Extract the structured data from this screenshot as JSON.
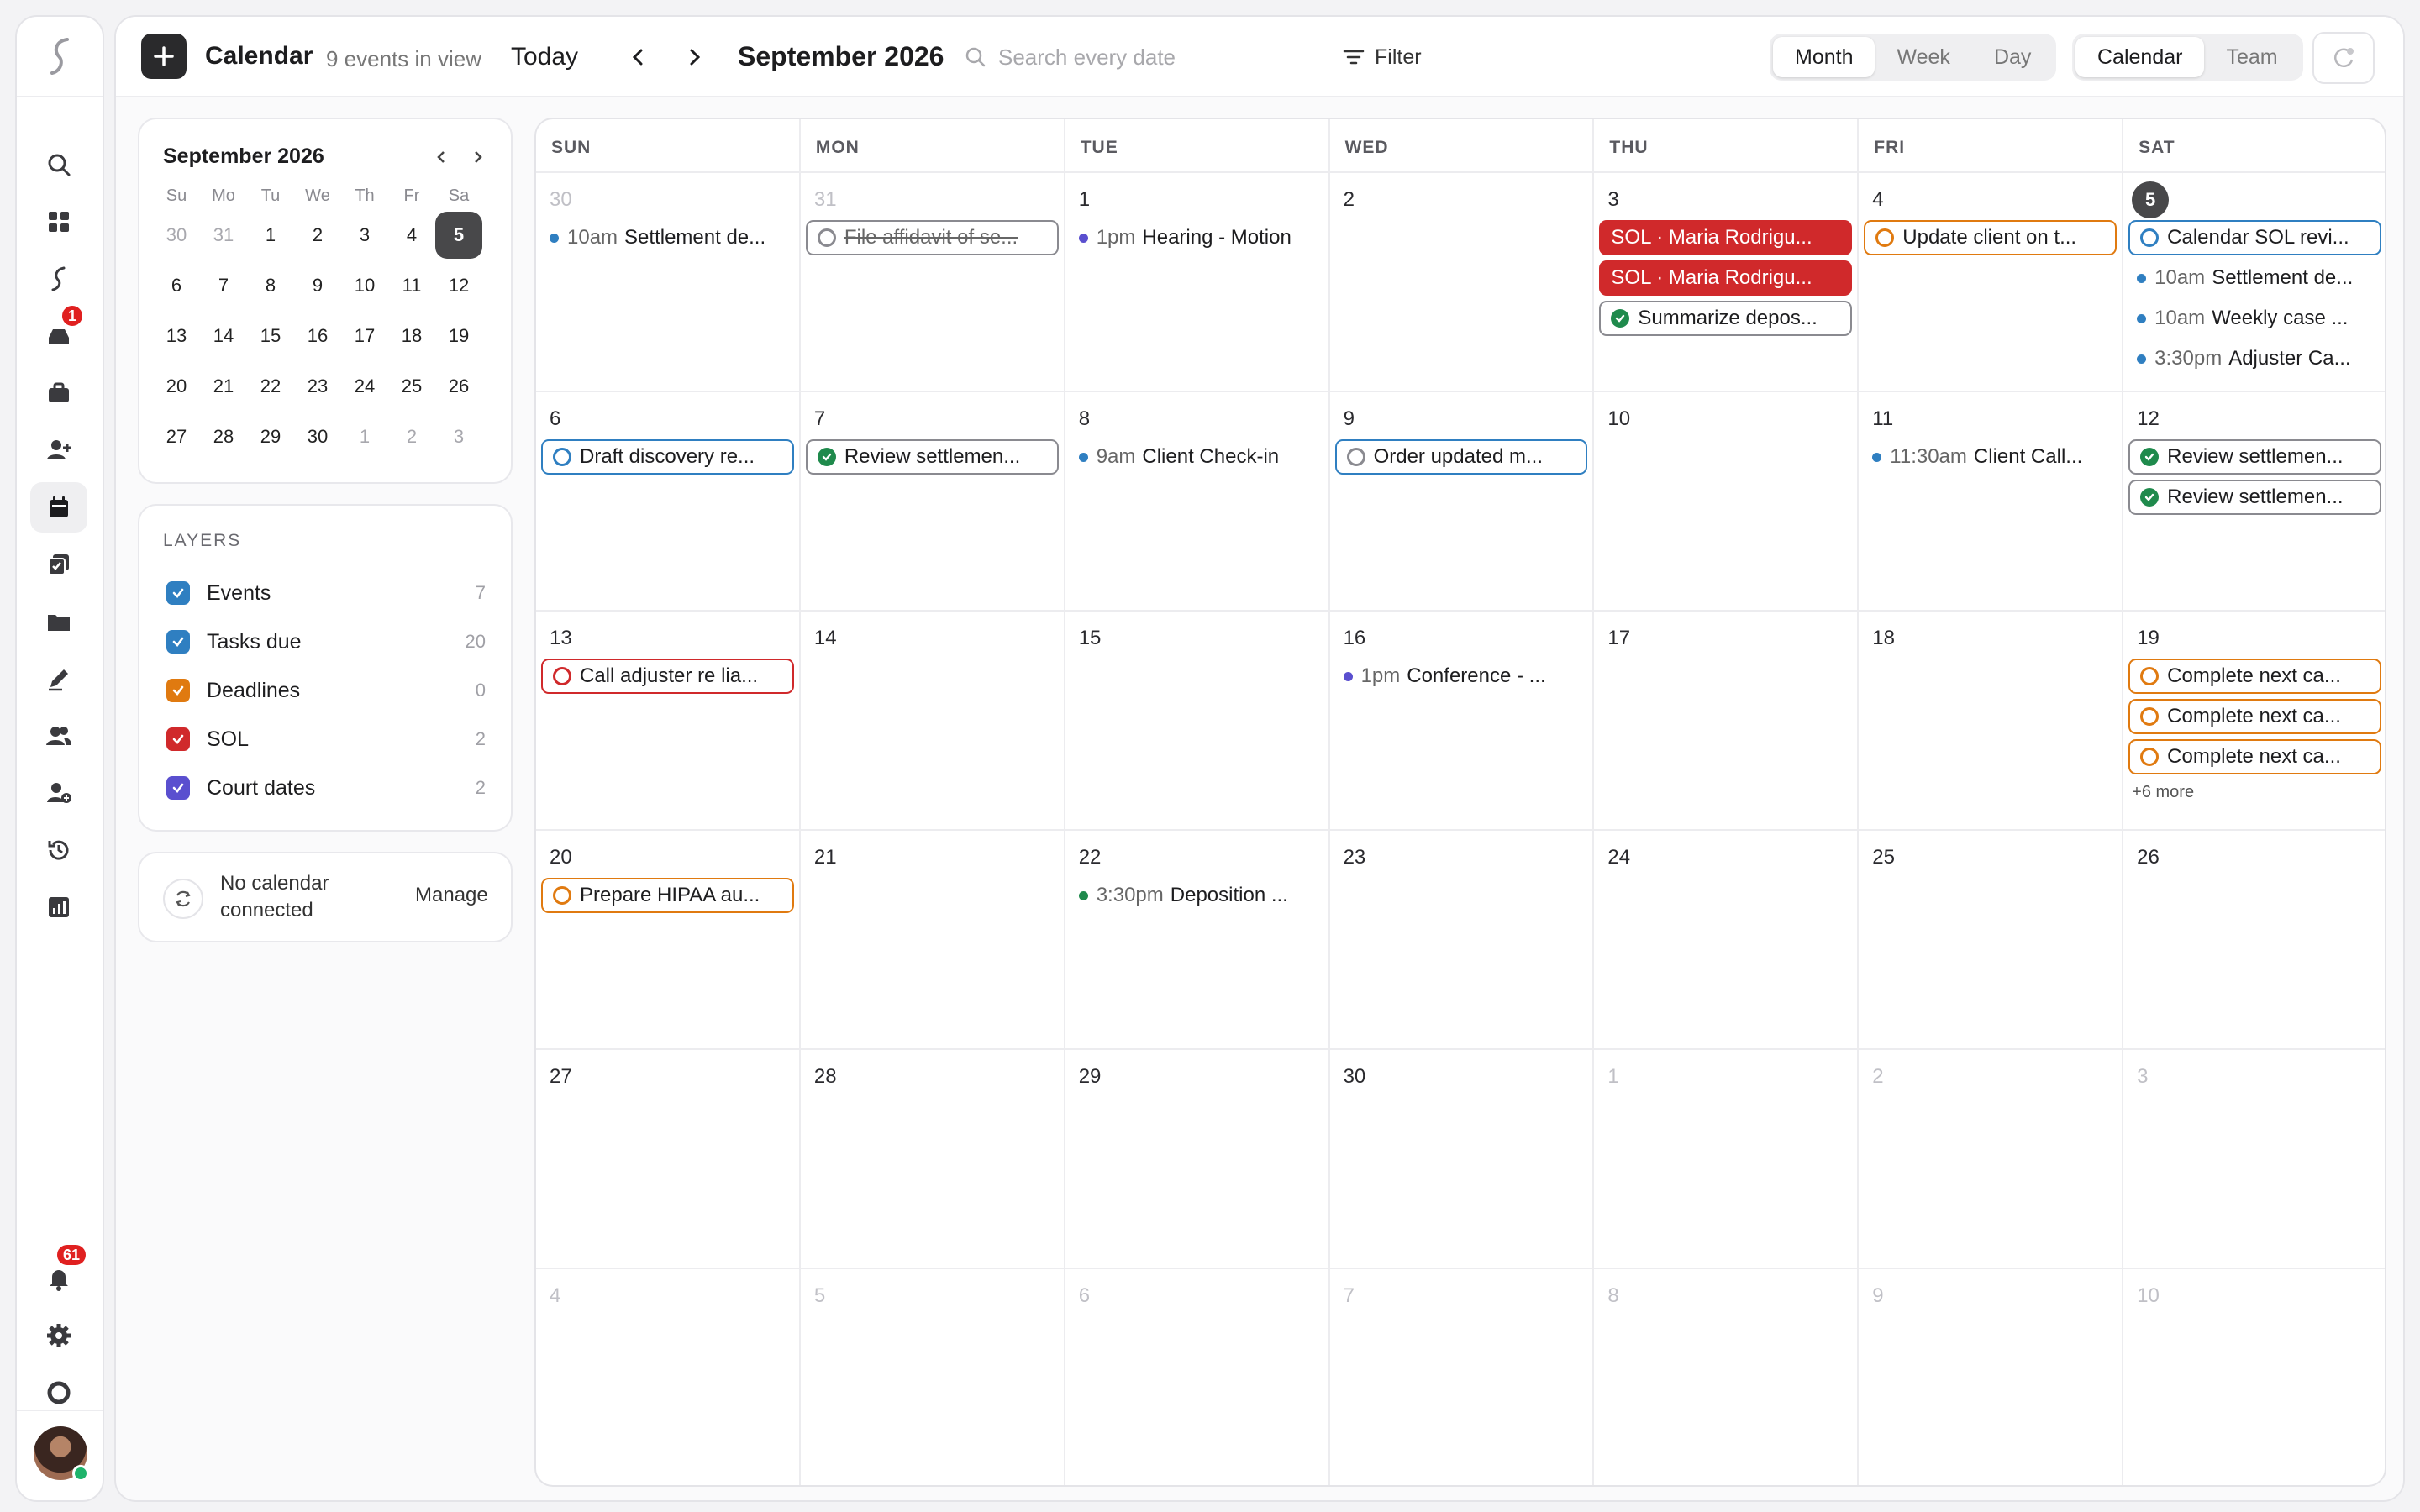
{
  "rail": {
    "badges": {
      "inbox": "1",
      "notifications": "61"
    }
  },
  "topbar": {
    "title": "Calendar",
    "count": "9 events in view",
    "today": "Today",
    "month": "September 2026",
    "search_placeholder": "Search every date",
    "filter": "Filter",
    "views": [
      "Month",
      "Week",
      "Day"
    ],
    "modes": [
      "Calendar",
      "Team"
    ]
  },
  "mini": {
    "title": "September 2026",
    "dow": [
      "Su",
      "Mo",
      "Tu",
      "We",
      "Th",
      "Fr",
      "Sa"
    ],
    "weeks": [
      [
        "30",
        "31",
        "1",
        "2",
        "3",
        "4",
        "5"
      ],
      [
        "6",
        "7",
        "8",
        "9",
        "10",
        "11",
        "12"
      ],
      [
        "13",
        "14",
        "15",
        "16",
        "17",
        "18",
        "19"
      ],
      [
        "20",
        "21",
        "22",
        "23",
        "24",
        "25",
        "26"
      ],
      [
        "27",
        "28",
        "29",
        "30",
        "1",
        "2",
        "3"
      ]
    ],
    "selected": "5"
  },
  "layers": {
    "title": "LAYERS",
    "items": [
      {
        "label": "Events",
        "count": "7",
        "color": "#2f7fc1"
      },
      {
        "label": "Tasks due",
        "count": "20",
        "color": "#2f7fc1"
      },
      {
        "label": "Deadlines",
        "count": "0",
        "color": "#e07a10"
      },
      {
        "label": "SOL",
        "count": "2",
        "color": "#d0292b"
      },
      {
        "label": "Court dates",
        "count": "2",
        "color": "#5a4fcf"
      }
    ]
  },
  "connection": {
    "text": "No calendar connected",
    "manage": "Manage"
  },
  "calendar": {
    "dow": [
      "SUN",
      "MON",
      "TUE",
      "WED",
      "THU",
      "FRI",
      "SAT"
    ],
    "weeks": [
      [
        {
          "day": "30",
          "dim": true,
          "events": [
            {
              "kind": "dot",
              "color": "#2f7fc1",
              "time": "10am",
              "title": "Settlement de..."
            }
          ]
        },
        {
          "day": "31",
          "dim": true,
          "events": [
            {
              "kind": "task",
              "state": "done",
              "color": "#8a8a90",
              "title": "File affidavit of se..."
            }
          ]
        },
        {
          "day": "1",
          "events": [
            {
              "kind": "dot",
              "color": "#5a4fcf",
              "time": "1pm",
              "title": "Hearing - Motion"
            }
          ]
        },
        {
          "day": "2",
          "events": []
        },
        {
          "day": "3",
          "events": [
            {
              "kind": "sol",
              "title": "SOL · Maria Rodrigu..."
            },
            {
              "kind": "sol",
              "title": "SOL · Maria Rodrigu..."
            },
            {
              "kind": "task",
              "state": "check",
              "color": "#8a8a90",
              "title": "Summarize depos..."
            }
          ]
        },
        {
          "day": "4",
          "events": [
            {
              "kind": "task",
              "state": "ring",
              "color": "#e07a10",
              "title": "Update client on t..."
            }
          ]
        },
        {
          "day": "5",
          "today": true,
          "events": [
            {
              "kind": "task",
              "state": "ring",
              "color": "#2f7fc1",
              "title": "Calendar SOL revi..."
            },
            {
              "kind": "dot",
              "color": "#2f7fc1",
              "time": "10am",
              "title": "Settlement de..."
            },
            {
              "kind": "dot",
              "color": "#2f7fc1",
              "time": "10am",
              "title": "Weekly case ..."
            },
            {
              "kind": "dot",
              "color": "#2f7fc1",
              "time": "3:30pm",
              "title": "Adjuster Ca..."
            }
          ]
        }
      ],
      [
        {
          "day": "6",
          "events": [
            {
              "kind": "task",
              "state": "ring",
              "color": "#2f7fc1",
              "title": "Draft discovery re..."
            }
          ]
        },
        {
          "day": "7",
          "events": [
            {
              "kind": "task",
              "state": "check",
              "color": "#8a8a90",
              "title": "Review settlemen..."
            }
          ]
        },
        {
          "day": "8",
          "events": [
            {
              "kind": "dot",
              "color": "#2f7fc1",
              "time": "9am",
              "title": "Client Check-in"
            }
          ]
        },
        {
          "day": "9",
          "events": [
            {
              "kind": "task",
              "state": "ring",
              "color": "#8a8a90",
              "ringColor": "#8a8a90",
              "border": "#2f7fc1",
              "title": "Order updated m..."
            }
          ]
        },
        {
          "day": "10",
          "events": []
        },
        {
          "day": "11",
          "events": [
            {
              "kind": "dot",
              "color": "#2f7fc1",
              "time": "11:30am",
              "title": "Client Call..."
            }
          ]
        },
        {
          "day": "12",
          "events": [
            {
              "kind": "task",
              "state": "check",
              "color": "#8a8a90",
              "title": "Review settlemen..."
            },
            {
              "kind": "task",
              "state": "check",
              "color": "#8a8a90",
              "title": "Review settlemen..."
            }
          ]
        }
      ],
      [
        {
          "day": "13",
          "events": [
            {
              "kind": "task",
              "state": "ring",
              "color": "#d0292b",
              "title": "Call adjuster re lia..."
            }
          ]
        },
        {
          "day": "14",
          "events": []
        },
        {
          "day": "15",
          "events": []
        },
        {
          "day": "16",
          "events": [
            {
              "kind": "dot",
              "color": "#5a4fcf",
              "time": "1pm",
              "title": "Conference - ..."
            }
          ]
        },
        {
          "day": "17",
          "events": []
        },
        {
          "day": "18",
          "events": []
        },
        {
          "day": "19",
          "events": [
            {
              "kind": "task",
              "state": "ring",
              "color": "#e07a10",
              "title": "Complete next ca..."
            },
            {
              "kind": "task",
              "state": "ring",
              "color": "#e07a10",
              "title": "Complete next ca..."
            },
            {
              "kind": "task",
              "state": "ring",
              "color": "#e07a10",
              "title": "Complete next ca..."
            }
          ],
          "more": "+6 more"
        }
      ],
      [
        {
          "day": "20",
          "events": [
            {
              "kind": "task",
              "state": "ring",
              "color": "#e07a10",
              "title": "Prepare HIPAA au..."
            }
          ]
        },
        {
          "day": "21",
          "events": []
        },
        {
          "day": "22",
          "events": [
            {
              "kind": "dot",
              "color": "#1f8a4c",
              "time": "3:30pm",
              "title": "Deposition ..."
            }
          ]
        },
        {
          "day": "23",
          "events": []
        },
        {
          "day": "24",
          "events": []
        },
        {
          "day": "25",
          "events": []
        },
        {
          "day": "26",
          "events": []
        }
      ],
      [
        {
          "day": "27",
          "events": []
        },
        {
          "day": "28",
          "events": []
        },
        {
          "day": "29",
          "events": []
        },
        {
          "day": "30",
          "events": []
        },
        {
          "day": "1",
          "dim": true,
          "events": []
        },
        {
          "day": "2",
          "dim": true,
          "events": []
        },
        {
          "day": "3",
          "dim": true,
          "events": []
        }
      ],
      [
        {
          "day": "4",
          "dim": true,
          "events": []
        },
        {
          "day": "5",
          "dim": true,
          "events": []
        },
        {
          "day": "6",
          "dim": true,
          "events": []
        },
        {
          "day": "7",
          "dim": true,
          "events": []
        },
        {
          "day": "8",
          "dim": true,
          "events": []
        },
        {
          "day": "9",
          "dim": true,
          "events": []
        },
        {
          "day": "10",
          "dim": true,
          "events": []
        }
      ]
    ]
  }
}
